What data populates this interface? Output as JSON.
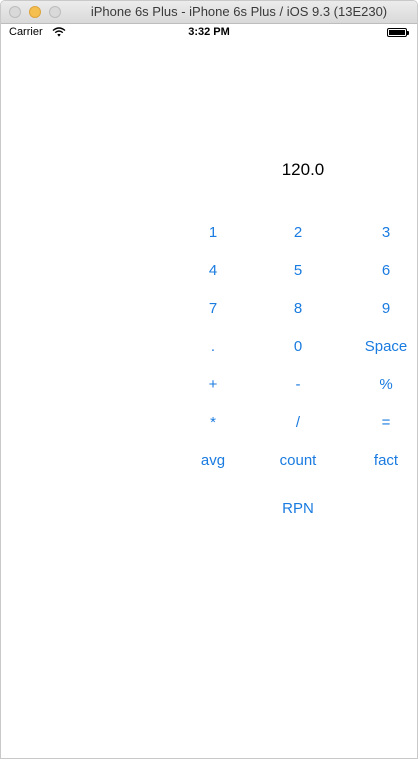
{
  "window": {
    "title": "iPhone 6s Plus - iPhone 6s Plus / iOS 9.3 (13E230)"
  },
  "status_bar": {
    "carrier": "Carrier",
    "time": "3:32 PM"
  },
  "calculator": {
    "display_value": "120.0",
    "keys": [
      "1",
      "2",
      "3",
      "4",
      "5",
      "6",
      "7",
      "8",
      "9",
      ".",
      "0",
      "Space",
      "+",
      "-",
      "%",
      "*",
      "/",
      "=",
      "avg",
      "count",
      "fact"
    ],
    "rpn_label": "RPN"
  },
  "colors": {
    "button_tint": "#1a7be0",
    "minimize_button": "#f5bf4f"
  }
}
